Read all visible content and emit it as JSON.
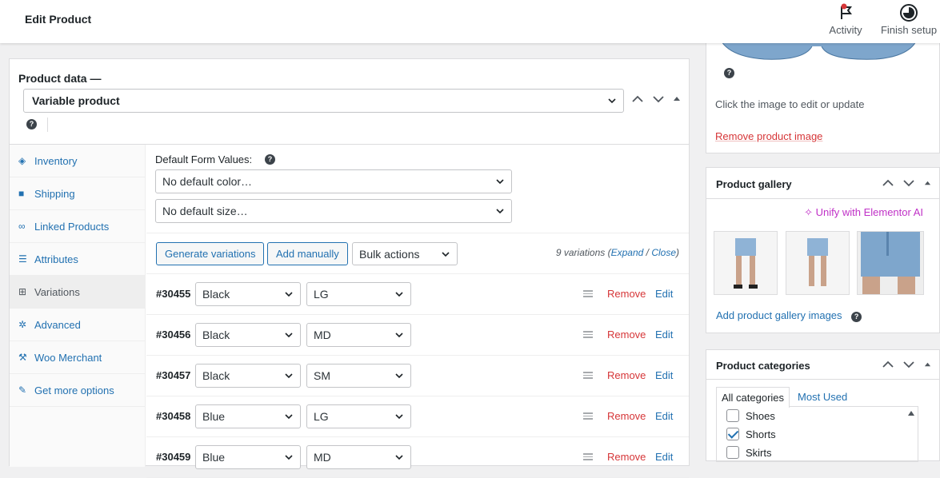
{
  "header": {
    "title": "Edit Product",
    "activity_label": "Activity",
    "finish_setup_label": "Finish setup"
  },
  "product_data": {
    "heading": "Product data —",
    "type_select": "Variable product",
    "tabs": [
      {
        "label": "Inventory",
        "icon": "tag-icon"
      },
      {
        "label": "Shipping",
        "icon": "truck-icon"
      },
      {
        "label": "Linked Products",
        "icon": "link-icon"
      },
      {
        "label": "Attributes",
        "icon": "list-icon"
      },
      {
        "label": "Variations",
        "icon": "grid-icon"
      },
      {
        "label": "Advanced",
        "icon": "gear-icon"
      },
      {
        "label": "Woo Merchant",
        "icon": "wrench-icon"
      },
      {
        "label": "Get more options",
        "icon": "plugin-icon"
      }
    ],
    "active_tab": "Variations"
  },
  "variations": {
    "default_form_values_label": "Default Form Values:",
    "default_color": "No default color…",
    "default_size": "No default size…",
    "generate_button": "Generate variations",
    "add_manually_button": "Add manually",
    "bulk_actions": "Bulk actions",
    "count_text": "9 variations",
    "expand_link": "Expand",
    "close_link": "Close",
    "remove_label": "Remove",
    "edit_label": "Edit",
    "rows": [
      {
        "id": "#30455",
        "color": "Black",
        "size": "LG"
      },
      {
        "id": "#30456",
        "color": "Black",
        "size": "MD"
      },
      {
        "id": "#30457",
        "color": "Black",
        "size": "SM"
      },
      {
        "id": "#30458",
        "color": "Blue",
        "size": "LG"
      },
      {
        "id": "#30459",
        "color": "Blue",
        "size": "MD"
      }
    ]
  },
  "product_image": {
    "hint": "Click the image to edit or update",
    "remove_link": "Remove product image"
  },
  "gallery": {
    "heading": "Product gallery",
    "unify_link": "Unify with Elementor AI",
    "add_link": "Add product gallery images"
  },
  "categories": {
    "heading": "Product categories",
    "tab_all": "All categories",
    "tab_most_used": "Most Used",
    "items": [
      {
        "label": "Shoes",
        "checked": false
      },
      {
        "label": "Shorts",
        "checked": true
      },
      {
        "label": "Skirts",
        "checked": false
      }
    ]
  },
  "colors": {
    "link": "#2271b1",
    "remove": "#d63638",
    "ai_accent": "#c031c7",
    "notice_dot": "#d63638"
  }
}
